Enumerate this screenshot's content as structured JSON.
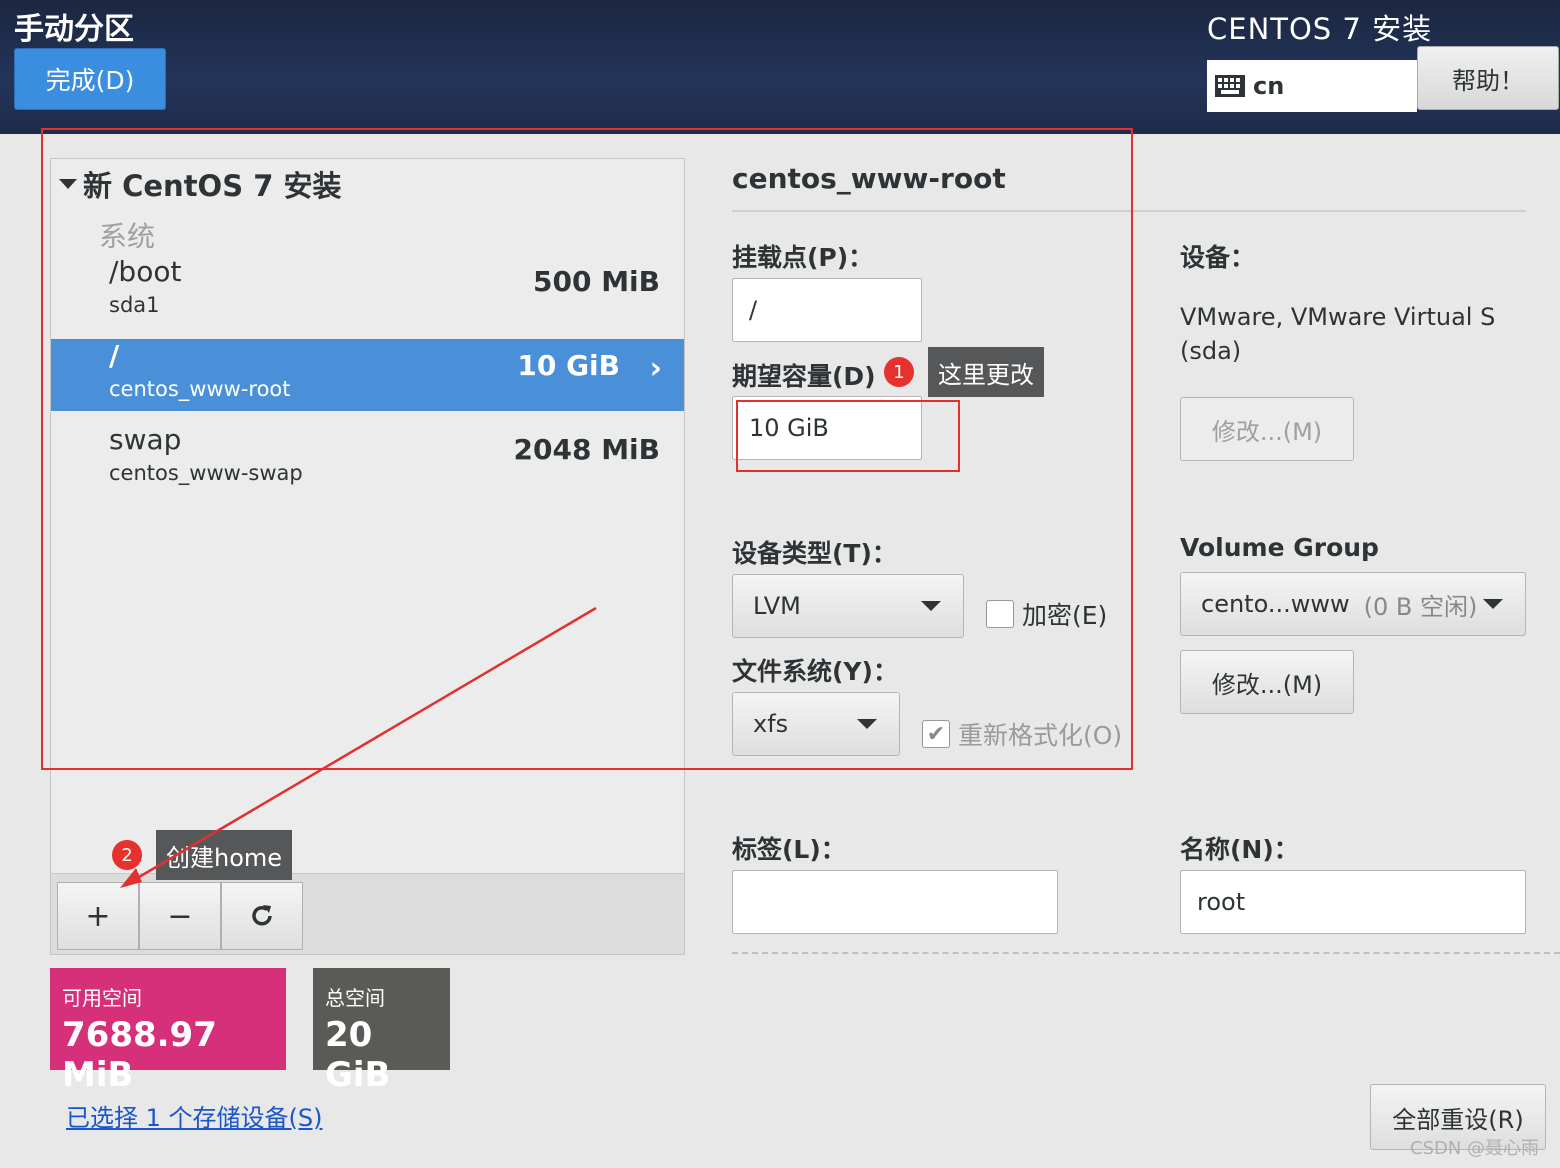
{
  "header": {
    "title": "手动分区",
    "done_button": "完成(D)",
    "product_title": "CENTOS 7 安装",
    "keyboard_layout": "cn",
    "help_button": "帮助！"
  },
  "left_panel": {
    "group_title": "新 CentOS 7 安装",
    "group_subtitle": "系统",
    "partitions": [
      {
        "mount": "/boot",
        "device": "sda1",
        "size": "500 MiB",
        "selected": false
      },
      {
        "mount": "/",
        "device": "centos_www-root",
        "size": "10 GiB",
        "selected": true
      },
      {
        "mount": "swap",
        "device": "centos_www-swap",
        "size": "2048 MiB",
        "selected": false
      }
    ],
    "toolbar": {
      "add": "+",
      "remove": "−",
      "refresh": "⟳"
    }
  },
  "space": {
    "available_label": "可用空间",
    "available_value": "7688.97 MiB",
    "available_color": "#d6307a",
    "total_label": "总空间",
    "total_value": "20 GiB",
    "total_color": "#5a5a56"
  },
  "storage_link": "已选择 1 个存储设备(S)",
  "detail": {
    "title": "centos_www-root",
    "mount_point_label": "挂载点(P)：",
    "mount_point_value": "/",
    "desired_capacity_label": "期望容量(D)",
    "desired_capacity_value": "10 GiB",
    "device_type_label": "设备类型(T)：",
    "device_type_value": "LVM",
    "encrypt_label": "加密(E)",
    "filesystem_label": "文件系统(Y)：",
    "filesystem_value": "xfs",
    "reformat_label": "重新格式化(O)",
    "devices_label": "设备：",
    "devices_value_line1": "VMware, VMware Virtual S",
    "devices_value_line2": "(sda)",
    "modify_button": "修改...(M)",
    "volume_group_label": "Volume Group",
    "volume_group_name": "cento...www",
    "volume_group_free": "(0 B 空闲)",
    "modify_vg_button": "修改...(M)",
    "label_label": "标签(L)：",
    "label_value": "",
    "name_label": "名称(N)：",
    "name_value": "root",
    "reset_all_button": "全部重设(R)"
  },
  "annotations": {
    "note1_number": "1",
    "note1_text": "这里更改",
    "note2_number": "2",
    "note2_text": "创建home",
    "color": "#e03131"
  },
  "watermark": "CSDN @聂心雨"
}
